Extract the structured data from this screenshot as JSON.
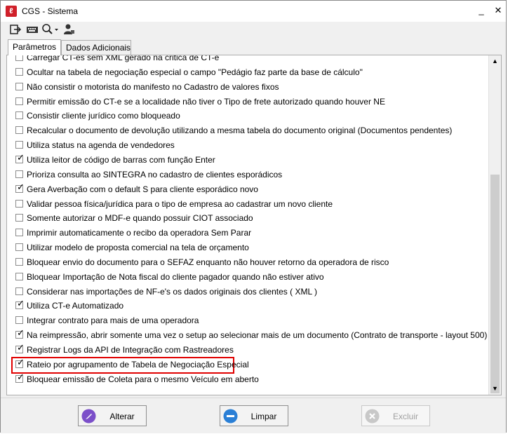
{
  "window": {
    "title": "CGS - Sistema",
    "minimize_glyph": "_",
    "close_glyph": "✕"
  },
  "toolbar": {
    "icons": [
      "exit-icon",
      "keyboard-icon",
      "search-icon",
      "user-icon"
    ]
  },
  "tabs": [
    {
      "label": "Parâmetros",
      "active": true
    },
    {
      "label": "Dados Adicionais",
      "active": false
    }
  ],
  "options": [
    {
      "label": "Carregar CT-es sem XML gerado na critica de CT-e",
      "checked": false
    },
    {
      "label": "Ocultar na tabela de negociação especial o campo \"Pedágio faz parte da base de cálculo\"",
      "checked": false
    },
    {
      "label": "Não consistir o motorista do manifesto no Cadastro de valores fixos",
      "checked": false
    },
    {
      "label": "Permitir emissão do CT-e se a localidade não tiver o Tipo de frete autorizado quando houver NE",
      "checked": false
    },
    {
      "label": "Consistir cliente jurídico como bloqueado",
      "checked": false
    },
    {
      "label": "Recalcular o documento de devolução utilizando a mesma tabela do documento original (Documentos pendentes)",
      "checked": false
    },
    {
      "label": "Utiliza status na agenda de vendedores",
      "checked": false
    },
    {
      "label": "Utiliza leitor de código de barras com função Enter",
      "checked": true
    },
    {
      "label": "Prioriza consulta ao SINTEGRA no cadastro de clientes esporádicos",
      "checked": false
    },
    {
      "label": "Gera Averbação com o default S para cliente esporádico novo",
      "checked": true
    },
    {
      "label": "Validar pessoa física/jurídica para o tipo de empresa ao cadastrar um novo cliente",
      "checked": false
    },
    {
      "label": "Somente autorizar o MDF-e quando possuir CIOT associado",
      "checked": false
    },
    {
      "label": "Imprimir automaticamente o recibo da operadora Sem Parar",
      "checked": false
    },
    {
      "label": "Utilizar modelo de proposta comercial na tela de orçamento",
      "checked": false
    },
    {
      "label": "Bloquear envio do documento para o SEFAZ  enquanto não houver retorno da operadora de risco",
      "checked": false
    },
    {
      "label": "Bloquear Importação de Nota fiscal do cliente pagador quando não estiver ativo",
      "checked": false
    },
    {
      "label": "Considerar nas importações de NF-e's os dados originais dos clientes ( XML )",
      "checked": false
    },
    {
      "label": "Utiliza CT-e Automatizado",
      "checked": true
    },
    {
      "label": "Integrar contrato para mais de uma operadora",
      "checked": false
    },
    {
      "label": "Na reimpressão, abrir somente uma vez o setup ao selecionar mais de um documento (Contrato de transporte - layout 500)",
      "checked": true
    },
    {
      "label": "Registrar Logs da API de Integração com Rastreadores",
      "checked": true
    },
    {
      "label": "Rateio por agrupamento de Tabela de Negociação Especial",
      "checked": true,
      "highlighted": true
    },
    {
      "label": "Bloquear emissão de Coleta para o mesmo Veículo em aberto",
      "checked": true
    }
  ],
  "footer": {
    "alterar_label": "Alterar",
    "limpar_label": "Limpar",
    "excluir_label": "Excluir",
    "colors": {
      "alterar_icon": "#7b4fc9",
      "limpar_icon": "#2a7fd6",
      "excluir_icon": "#c8c8c8"
    }
  },
  "check_glyph": "✓",
  "scroll_up_glyph": "▲",
  "scroll_down_glyph": "▼"
}
